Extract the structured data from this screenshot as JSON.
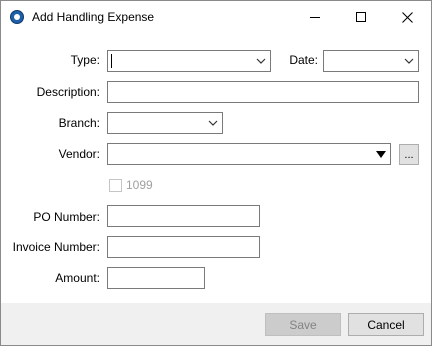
{
  "window": {
    "title": "Add Handling Expense"
  },
  "form": {
    "type": {
      "label": "Type:",
      "value": ""
    },
    "date": {
      "label": "Date:",
      "value": ""
    },
    "description": {
      "label": "Description:",
      "value": ""
    },
    "branch": {
      "label": "Branch:",
      "value": ""
    },
    "vendor": {
      "label": "Vendor:",
      "value": "",
      "browse_label": "..."
    },
    "form1099": {
      "label": "1099",
      "checked": false,
      "enabled": false
    },
    "po_number": {
      "label": "PO Number:",
      "value": ""
    },
    "invoice_number": {
      "label": "Invoice Number:",
      "value": ""
    },
    "amount": {
      "label": "Amount:",
      "value": ""
    }
  },
  "footer": {
    "save_label": "Save",
    "save_enabled": false,
    "cancel_label": "Cancel"
  }
}
